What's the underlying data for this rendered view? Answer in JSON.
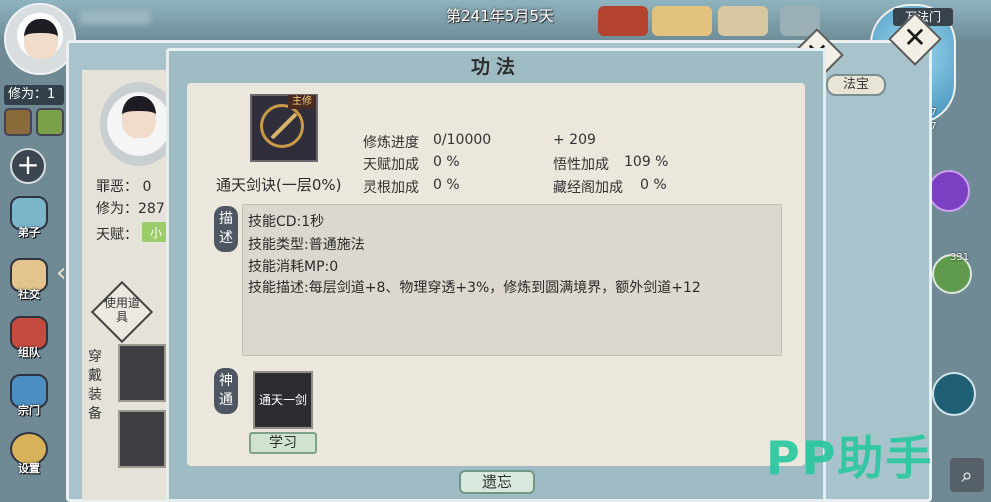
{
  "hud": {
    "date": "第241年5月5天",
    "xiuwei_tag": "修为：1",
    "sect_name": "万法门",
    "right_counts": [
      "27",
      "27",
      "331"
    ],
    "left_menu": [
      "弟子",
      "社交",
      "组队",
      "宗门",
      "设置"
    ]
  },
  "character": {
    "crime_label": "罪恶：",
    "crime_value": "0",
    "xiuwei_label": "修为：",
    "xiuwei_value": "287",
    "talent_label": "天赋：",
    "talent_value": "小",
    "use_item": "使用道具",
    "equip_title": "穿戴装备",
    "fabao_tab": "法宝"
  },
  "dialog": {
    "title": "功法",
    "main_badge": "主修",
    "skill_name": "通天剑诀(一层0%)",
    "progress_label": "修炼进度",
    "progress_value": "0/10000",
    "progress_gain": "+ 209",
    "talent_bonus_label": "天赋加成",
    "talent_bonus_value": "0 %",
    "insight_label": "悟性加成",
    "insight_value": "109 %",
    "root_label": "灵根加成",
    "root_value": "0 %",
    "library_label": "藏经阁加成",
    "library_value": "0 %",
    "desc_tab": "描述",
    "desc_lines": [
      "技能CD:1秒",
      "技能类型:普通施法",
      "技能消耗MP:0",
      "技能描述:每层剑道+8、物理穿透+3%，修炼到圆满境界，额外剑道+12"
    ],
    "shentong_tab": "神通",
    "shentong_skill": "通天一剑",
    "learn_button": "学习",
    "forget_button": "遗忘"
  },
  "watermark": "PP助手",
  "colors": {
    "panel_bg": "#9fbcc4",
    "content_bg": "#ebe7dd",
    "watermark": "#27c8a0"
  }
}
